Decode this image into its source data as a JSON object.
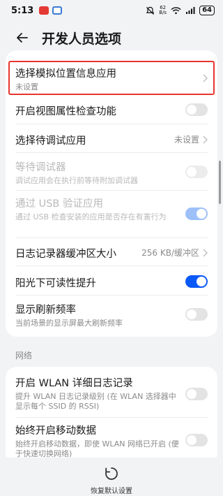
{
  "status_bar": {
    "time": "5:13",
    "net_speed_top": "62",
    "net_speed_bottom": "B/s",
    "battery": "64"
  },
  "header": {
    "title": "开发人员选项"
  },
  "items": {
    "mock_location": {
      "title": "选择模拟位置信息应用",
      "subtitle": "未设置"
    },
    "view_attr": {
      "title": "开启视图属性检查功能"
    },
    "debug_app": {
      "title": "选择待调试应用",
      "value": "未设置"
    },
    "wait_debugger": {
      "title": "等待调试器",
      "subtitle": "调试应用会在执行前等待附加调试器"
    },
    "usb_verify": {
      "title": "通过 USB 验证应用",
      "subtitle": "通过 USB 检查安装的应用是否存在有害行为"
    },
    "logger_buffer": {
      "title": "日志记录器缓冲区大小",
      "value": "256 KB/缓冲区"
    },
    "sunlight": {
      "title": "阳光下可读性提升"
    },
    "refresh_rate": {
      "title": "显示刷新频率",
      "subtitle": "当前场景的显示屏最大刷新频率"
    }
  },
  "network": {
    "section_label": "网络",
    "wlan_log": {
      "title": "开启 WLAN 详细日志记录",
      "subtitle": "提升 WLAN 日志记录级别 (在 WLAN 选择器中显示每个 SSID 的 RSSI)"
    },
    "mobile_data": {
      "title": "始终开启移动数据",
      "subtitle": "始终开启移动数据，即使 WLAN 网络已开启 (便于快速切换网络)"
    }
  },
  "bottom": {
    "restore_label": "恢复默认设置"
  },
  "colors": {
    "accent": "#0a59f7",
    "highlight_border": "#e8352f",
    "background": "#f1f3f5"
  }
}
